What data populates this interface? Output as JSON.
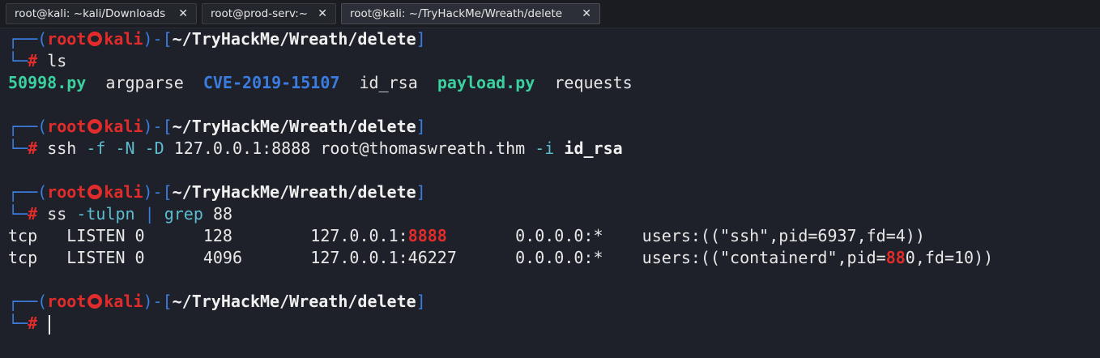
{
  "tabs": [
    {
      "label": "root@kali: ~kali/Downloads",
      "close": "✕"
    },
    {
      "label": "root@prod-serv:~",
      "close": "✕"
    },
    {
      "label": "root@kali: ~/TryHackMe/Wreath/delete",
      "close": "✕"
    }
  ],
  "prompt": {
    "open": "┌──(",
    "user": "root",
    "host": "kali",
    "mid": ")-[",
    "path": "~/TryHackMe/Wreath/delete",
    "close": "]",
    "corner": "└─",
    "hash": "#"
  },
  "block1": {
    "cmd": "ls",
    "files": {
      "f1": "50998.py",
      "f2": "argparse",
      "f3": "CVE-2019-15107",
      "f4": "id_rsa",
      "f5": "payload.py",
      "f6": "requests"
    }
  },
  "block2": {
    "c1": "ssh",
    "c2": "-f -N -D",
    "c3": "127.0.0.1:8888 root@thomaswreath.thm",
    "c4": "-i",
    "c5": "id_rsa"
  },
  "block3": {
    "c1": "ss",
    "c2": "-tulpn",
    "c3": "|",
    "c4": "grep",
    "c5": "88",
    "row1": {
      "pre": "tcp   LISTEN 0      128        127.0.0.1:",
      "hl": "8888",
      "post": "       0.0.0.0:*    users:((\"ssh\",pid=6937,fd=4))"
    },
    "row2": {
      "pre": "tcp   LISTEN 0      4096       127.0.0.1:46227      0.0.0.0:*    users:((\"containerd\",pid=",
      "hl": "88",
      "post": "0,fd=10))"
    }
  }
}
